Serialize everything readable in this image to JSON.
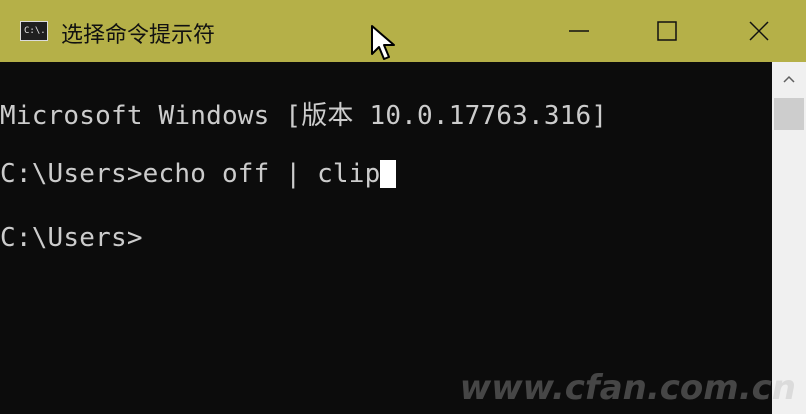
{
  "window": {
    "title": "选择命令提示符",
    "icon_label": "C:\\.",
    "controls": {
      "minimize": "minimize-icon",
      "maximize": "maximize-icon",
      "close": "close-icon"
    }
  },
  "console": {
    "lines": [
      "Microsoft Windows [版本 10.0.17763.316]",
      "C:\\Users>echo off | clip",
      "C:\\Users>"
    ]
  },
  "watermark": "www.cfan.com.cn",
  "colors": {
    "titlebar": "#b5b048",
    "console_bg": "#0c0c0c",
    "console_text": "#cccccc"
  }
}
